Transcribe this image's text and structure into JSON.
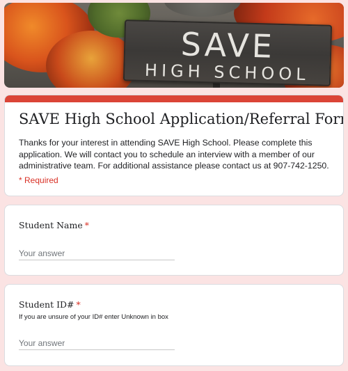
{
  "banner": {
    "sign_line1": "SAVE",
    "sign_line2": "HIGH SCHOOL"
  },
  "form": {
    "title": "SAVE High School Application/Referral Form",
    "description": "Thanks for your interest in attending SAVE High School. Please complete this application. We will contact you to schedule an interview with a member of our administrative team. For additional assistance please contact us at 907-742-1250.",
    "required_note": "* Required",
    "accent_color": "#db4437"
  },
  "questions": [
    {
      "label": "Student Name",
      "required_marker": "*",
      "help_text": "",
      "placeholder": "Your answer"
    },
    {
      "label": "Student ID#",
      "required_marker": "*",
      "help_text": "If you are unsure of your ID# enter Unknown in box",
      "placeholder": "Your answer"
    }
  ]
}
